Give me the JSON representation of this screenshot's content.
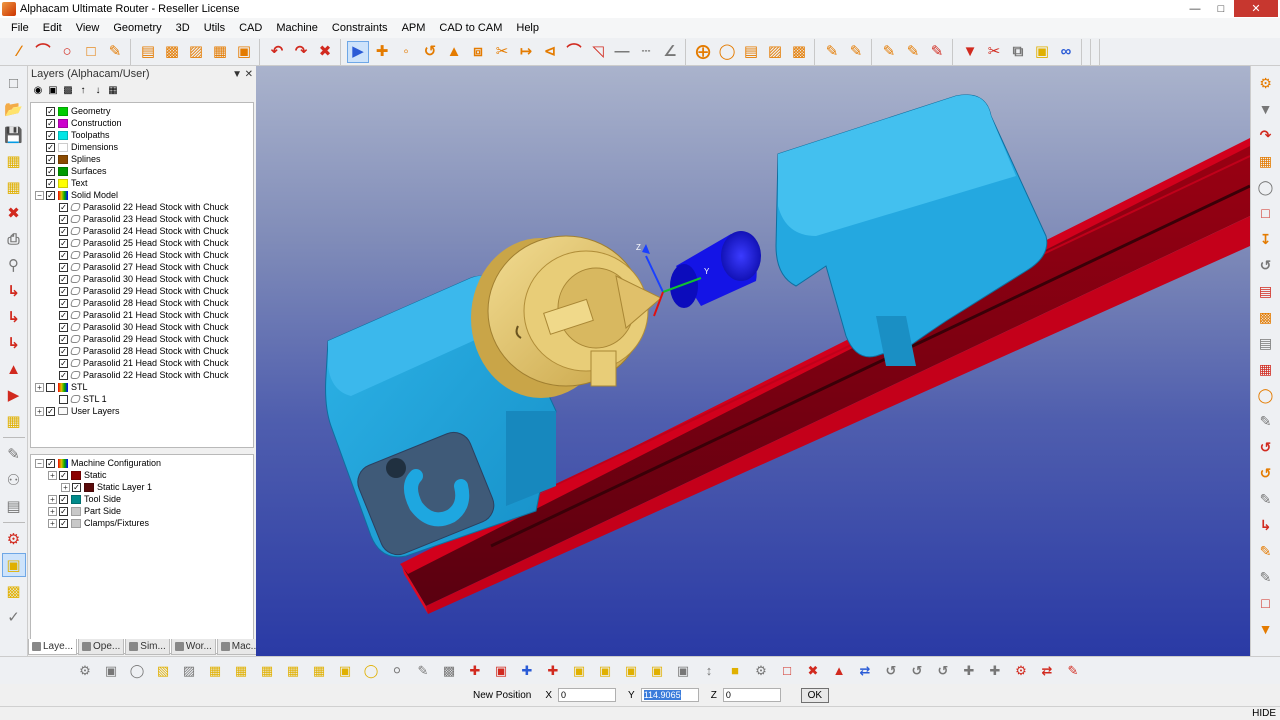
{
  "window": {
    "title": "Alphacam Ultimate Router - Reseller License"
  },
  "menu": [
    "File",
    "Edit",
    "View",
    "Geometry",
    "3D",
    "Utils",
    "CAD",
    "Machine",
    "Constraints",
    "APM",
    "CAD to CAM",
    "Help"
  ],
  "layers_panel": {
    "title": "Layers (Alphacam/User)",
    "top_tree": [
      {
        "label": "Geometry",
        "color": "#00cc00",
        "level": 0,
        "expander": false,
        "checked": true,
        "kind": "swatch"
      },
      {
        "label": "Construction",
        "color": "#cc00cc",
        "level": 0,
        "expander": false,
        "checked": true,
        "kind": "swatch"
      },
      {
        "label": "Toolpaths",
        "color": "#00e5e5",
        "level": 0,
        "expander": false,
        "checked": true,
        "kind": "swatch"
      },
      {
        "label": "Dimensions",
        "color": "#ffffff",
        "level": 0,
        "expander": false,
        "checked": true,
        "kind": "swatch"
      },
      {
        "label": "Splines",
        "color": "#8b4a00",
        "level": 0,
        "expander": false,
        "checked": true,
        "kind": "swatch"
      },
      {
        "label": "Surfaces",
        "color": "#009900",
        "level": 0,
        "expander": false,
        "checked": true,
        "kind": "swatch"
      },
      {
        "label": "Text",
        "color": "#ffff00",
        "level": 0,
        "expander": false,
        "checked": true,
        "kind": "swatch"
      },
      {
        "label": "Solid Model",
        "color": "",
        "level": 0,
        "expander": true,
        "checked": true,
        "kind": "rainbow"
      },
      {
        "label": "Parasolid 22 Head Stock with Chuck",
        "level": 1,
        "expander": false,
        "checked": true,
        "kind": "solid"
      },
      {
        "label": "Parasolid 23 Head Stock with Chuck",
        "level": 1,
        "expander": false,
        "checked": true,
        "kind": "solid"
      },
      {
        "label": "Parasolid 24 Head Stock with Chuck",
        "level": 1,
        "expander": false,
        "checked": true,
        "kind": "solid"
      },
      {
        "label": "Parasolid 25 Head Stock with Chuck",
        "level": 1,
        "expander": false,
        "checked": true,
        "kind": "solid"
      },
      {
        "label": "Parasolid 26 Head Stock with Chuck",
        "level": 1,
        "expander": false,
        "checked": true,
        "kind": "solid"
      },
      {
        "label": "Parasolid 27 Head Stock with Chuck",
        "level": 1,
        "expander": false,
        "checked": true,
        "kind": "solid"
      },
      {
        "label": "Parasolid 30 Head Stock with Chuck",
        "level": 1,
        "expander": false,
        "checked": true,
        "kind": "solid"
      },
      {
        "label": "Parasolid 29 Head Stock with Chuck",
        "level": 1,
        "expander": false,
        "checked": true,
        "kind": "solid"
      },
      {
        "label": "Parasolid 28 Head Stock with Chuck",
        "level": 1,
        "expander": false,
        "checked": true,
        "kind": "solid"
      },
      {
        "label": "Parasolid 21 Head Stock with Chuck",
        "level": 1,
        "expander": false,
        "checked": true,
        "kind": "solid"
      },
      {
        "label": "Parasolid 30 Head Stock with Chuck",
        "level": 1,
        "expander": false,
        "checked": true,
        "kind": "solid"
      },
      {
        "label": "Parasolid 29 Head Stock with Chuck",
        "level": 1,
        "expander": false,
        "checked": true,
        "kind": "solid"
      },
      {
        "label": "Parasolid 28 Head Stock with Chuck",
        "level": 1,
        "expander": false,
        "checked": true,
        "kind": "solid"
      },
      {
        "label": "Parasolid 21 Head Stock with Chuck",
        "level": 1,
        "expander": false,
        "checked": true,
        "kind": "solid"
      },
      {
        "label": "Parasolid 22 Head Stock with Chuck",
        "level": 1,
        "expander": false,
        "checked": true,
        "kind": "solid"
      },
      {
        "label": "STL",
        "level": 0,
        "expander": true,
        "checked": false,
        "kind": "rainbow"
      },
      {
        "label": "STL 1",
        "level": 1,
        "expander": false,
        "checked": false,
        "kind": "solid"
      },
      {
        "label": "User Layers",
        "level": 0,
        "expander": true,
        "checked": true,
        "kind": "user"
      }
    ],
    "bottom_tree": [
      {
        "label": "Machine Configuration",
        "level": 0,
        "expander": true,
        "checked": true,
        "kind": "rainbow"
      },
      {
        "label": "Static",
        "color": "#8b0000",
        "level": 1,
        "expander": true,
        "checked": true,
        "kind": "swatch"
      },
      {
        "label": "Static Layer 1",
        "color": "#5a0a0a",
        "level": 2,
        "expander": true,
        "checked": true,
        "kind": "swatch"
      },
      {
        "label": "Tool Side",
        "color": "#008b8b",
        "level": 1,
        "expander": true,
        "checked": true,
        "kind": "swatch"
      },
      {
        "label": "Part Side",
        "color": "#c8c8c8",
        "level": 1,
        "expander": true,
        "checked": true,
        "kind": "swatch"
      },
      {
        "label": "Clamps/Fixtures",
        "color": "#c8c8c8",
        "level": 1,
        "expander": true,
        "checked": true,
        "kind": "swatch"
      }
    ],
    "tabs": [
      "Laye...",
      "Ope...",
      "Sim...",
      "Wor...",
      "Mac..."
    ]
  },
  "input_bar": {
    "label": "New Position",
    "x_label": "X",
    "x_value": "0",
    "y_label": "Y",
    "y_value": "114.9065",
    "z_label": "Z",
    "z_value": "0",
    "ok": "OK"
  },
  "status_bar": {
    "right": "HIDE"
  },
  "colors": {
    "headstock": "#1fa0d8",
    "chuck": "#e3c46a",
    "rail": "#b8001a",
    "cylinder": "#1414e6"
  },
  "icons": {
    "top": [
      "line-icon",
      "arc-icon",
      "circle-icon",
      "rectangle-icon",
      "draw-icon",
      "layer-icon-1",
      "layer-icon-2",
      "layer-icon-3",
      "layer-icon-4",
      "layer-icon-5",
      "undo-icon",
      "redo-icon",
      "delete-icon",
      "select-icon",
      "move-icon",
      "copy-icon",
      "rotate-icon",
      "mirror-icon",
      "scale-icon",
      "trim-icon",
      "extend-icon",
      "break-icon",
      "fillet-icon",
      "chamfer-icon",
      "dimension-icon",
      "dim-vertical-icon",
      "dim-angle-icon",
      "snap-icon",
      "snap-circle-icon",
      "toolpath-icon-1",
      "toolpath-icon-2",
      "toolpath-icon-3",
      "edit-icon-1",
      "edit-icon-2",
      "edit-icon-3",
      "edit-icon-4",
      "edit-icon-5",
      "drill-icon",
      "cut-icon",
      "measure-icon",
      "database-icon",
      "link-icon"
    ],
    "left": [
      "new-icon",
      "open-icon",
      "save-icon",
      "nc-icon",
      "nc-output-icon",
      "delete-red-icon",
      "print-icon",
      "zoom-icon",
      "arrow-icon-1",
      "arrow-icon-2",
      "arrow-icon-3",
      "move-red-icon",
      "play-icon",
      "nc-run-icon",
      "pen-icon",
      "drill-bit-icon",
      "ruler-icon",
      "gears-icon",
      "cube-icon",
      "rect-select-icon",
      "check-icon"
    ],
    "right": [
      "tool-icon-1",
      "tool-icon-2",
      "tool-icon-3",
      "tool-icon-4",
      "tool-icon-5",
      "tool-icon-6",
      "tool-icon-7",
      "tool-icon-8",
      "tool-icon-9",
      "tool-icon-10",
      "tool-icon-11",
      "tool-icon-12",
      "tool-icon-13",
      "tool-icon-14",
      "tool-icon-15",
      "tool-icon-16",
      "tool-icon-17",
      "tool-icon-18",
      "tool-icon-19",
      "tool-icon-20",
      "square-icon",
      "filter-icon"
    ],
    "bottom": [
      "view-icon-1",
      "view-icon-2",
      "view-icon-3",
      "view-icon-4",
      "view-icon-5",
      "view-icon-6",
      "view-icon-7",
      "view-icon-8",
      "view-icon-9",
      "view-icon-10",
      "view-icon-11",
      "view-icon-12",
      "view-icon-13",
      "view-icon-14",
      "view-icon-15",
      "view-icon-16",
      "view-icon-17",
      "view-icon-18",
      "view-icon-19",
      "view-icon-20",
      "view-icon-21",
      "view-icon-22",
      "view-icon-23",
      "view-icon-24",
      "view-icon-25",
      "view-icon-26",
      "view-icon-27",
      "view-icon-28",
      "view-icon-29",
      "view-icon-30",
      "view-icon-31",
      "view-icon-32",
      "view-icon-33",
      "view-icon-34",
      "view-icon-35",
      "view-icon-36",
      "view-icon-37",
      "view-icon-38",
      "view-icon-39"
    ]
  }
}
